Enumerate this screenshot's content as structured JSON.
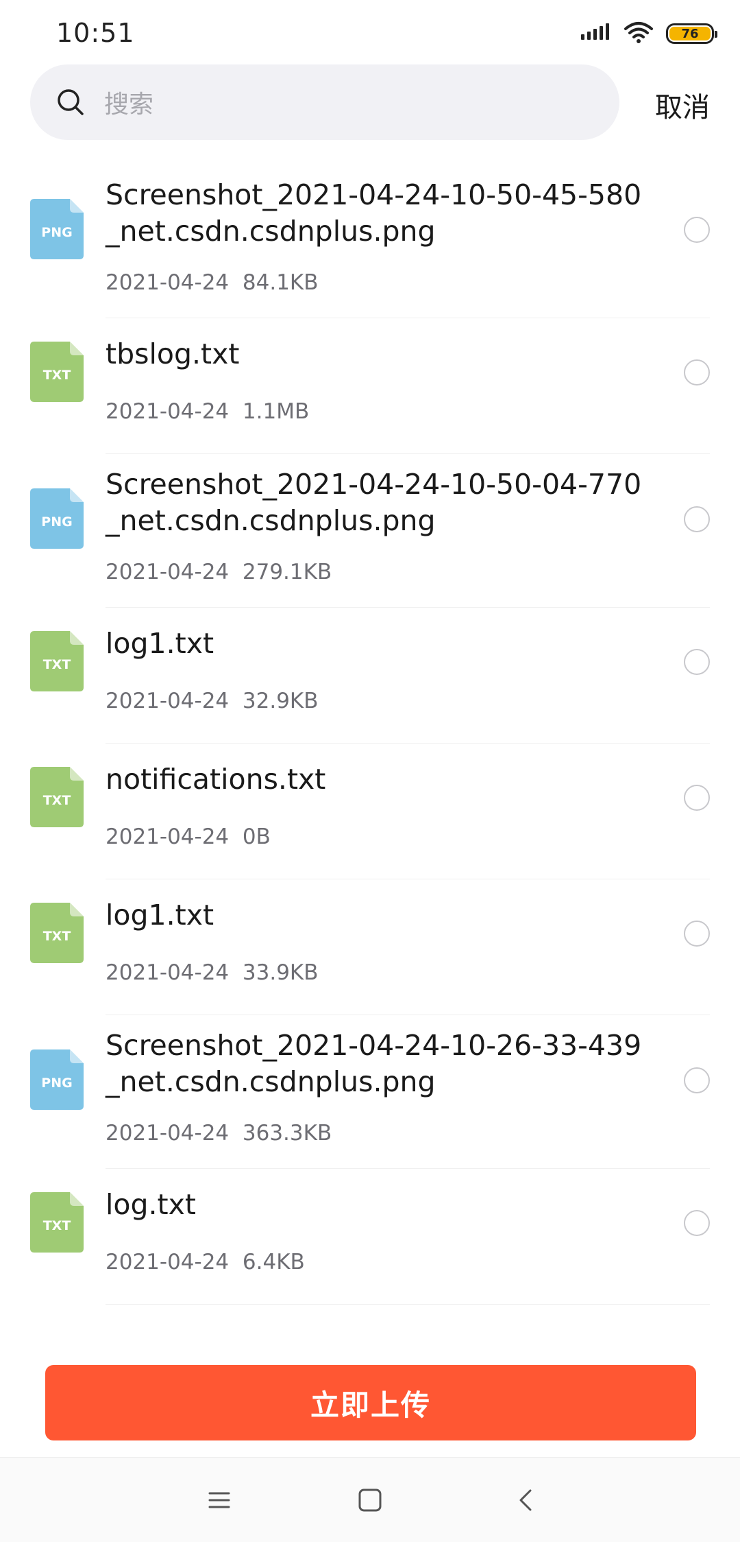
{
  "status_bar": {
    "time": "10:51",
    "battery_level": "76",
    "battery_color": "#f5b400",
    "icons": [
      "signal-icon",
      "wifi-icon",
      "battery-icon"
    ]
  },
  "search": {
    "placeholder": "搜索",
    "cancel_label": "取消"
  },
  "files": [
    {
      "type": "PNG",
      "name": "Screenshot_2021-04-24-10-50-45-580_net.csdn.csdnplus.png",
      "date": "2021-04-24",
      "size": "84.1KB",
      "selected": false
    },
    {
      "type": "TXT",
      "name": "tbslog.txt",
      "date": "2021-04-24",
      "size": "1.1MB",
      "selected": false
    },
    {
      "type": "PNG",
      "name": "Screenshot_2021-04-24-10-50-04-770_net.csdn.csdnplus.png",
      "date": "2021-04-24",
      "size": "279.1KB",
      "selected": false
    },
    {
      "type": "TXT",
      "name": "log1.txt",
      "date": "2021-04-24",
      "size": "32.9KB",
      "selected": false
    },
    {
      "type": "TXT",
      "name": "notifications.txt",
      "date": "2021-04-24",
      "size": "0B",
      "selected": false
    },
    {
      "type": "TXT",
      "name": "log1.txt",
      "date": "2021-04-24",
      "size": "33.9KB",
      "selected": false
    },
    {
      "type": "PNG",
      "name": "Screenshot_2021-04-24-10-26-33-439_net.csdn.csdnplus.png",
      "date": "2021-04-24",
      "size": "363.3KB",
      "selected": false
    },
    {
      "type": "TXT",
      "name": "log.txt",
      "date": "2021-04-24",
      "size": "6.4KB",
      "selected": false
    }
  ],
  "colors": {
    "png_icon": "#7ec4e6",
    "txt_icon": "#9fcb74",
    "accent": "#ff5733"
  },
  "upload_button": {
    "label": "立即上传"
  },
  "nav_bar": {
    "icons": [
      "menu-icon",
      "home-icon",
      "back-icon"
    ]
  }
}
